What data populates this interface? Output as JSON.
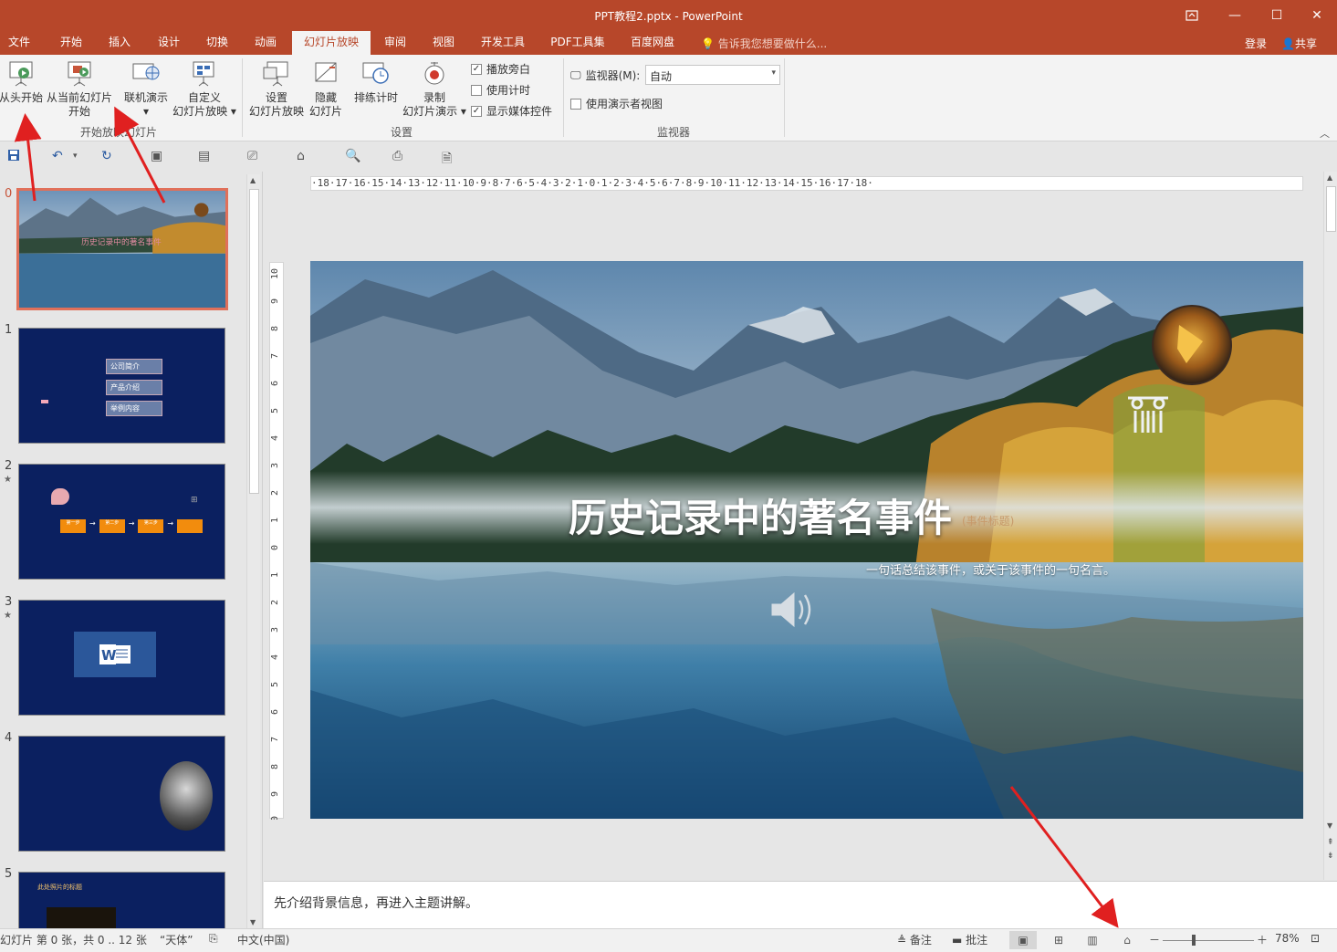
{
  "window": {
    "title": "PPT教程2.pptx - PowerPoint",
    "restore_icon": "restore-icon",
    "minimize": "—",
    "maximize": "☐",
    "close": "✕"
  },
  "tabs": [
    {
      "label": "文件"
    },
    {
      "label": "开始"
    },
    {
      "label": "插入"
    },
    {
      "label": "设计"
    },
    {
      "label": "切换"
    },
    {
      "label": "动画"
    },
    {
      "label": "幻灯片放映"
    },
    {
      "label": "审阅"
    },
    {
      "label": "视图"
    },
    {
      "label": "开发工具"
    },
    {
      "label": "PDF工具集"
    },
    {
      "label": "百度网盘"
    }
  ],
  "tellme": "告诉我您想要做什么...",
  "login": "登录",
  "share": "共享",
  "ribbon": {
    "start_group": {
      "from_beginning": "从头开始",
      "from_current_1": "从当前幻灯片",
      "from_current_2": "开始",
      "online_1": "联机演示",
      "online_2": "▾",
      "custom_1": "自定义",
      "custom_2": "幻灯片放映 ▾",
      "label": "开始放映幻灯片"
    },
    "setup_group": {
      "setup_1": "设置",
      "setup_2": "幻灯片放映",
      "hide_1": "隐藏",
      "hide_2": "幻灯片",
      "rehearse": "排练计时",
      "record_1": "录制",
      "record_2": "幻灯片演示 ▾",
      "play_narration": "播放旁白",
      "use_timings": "使用计时",
      "show_media": "显示媒体控件",
      "label": "设置"
    },
    "monitor_group": {
      "monitor_label": "监视器(M):",
      "monitor_value": "自动",
      "presenter_view": "使用演示者视图",
      "label": "监视器"
    }
  },
  "thumbnails": [
    {
      "num": "0",
      "star": ""
    },
    {
      "num": "1",
      "star": ""
    },
    {
      "num": "2",
      "star": "★"
    },
    {
      "num": "3",
      "star": "★"
    },
    {
      "num": "4",
      "star": ""
    },
    {
      "num": "5",
      "star": ""
    }
  ],
  "thumb_text": {
    "t1_items": [
      "公司简介",
      "产品介绍",
      "举例内容"
    ],
    "t2_items": [
      "第一步",
      "第二步",
      "第三步"
    ],
    "t5_title": "此处照片的标题"
  },
  "ruler": {
    "h": "·18·17·16·15·14·13·12·11·10·9·8·7·6·5·4·3·2·1·0·1·2·3·4·5·6·7·8·9·10·11·12·13·14·15·16·17·18·",
    "v": [
      "10",
      "9",
      "8",
      "7",
      "6",
      "5",
      "4",
      "3",
      "2",
      "1",
      "0",
      "1",
      "2",
      "3",
      "4",
      "5",
      "6",
      "7",
      "8",
      "9",
      "10"
    ]
  },
  "slide": {
    "title": "历史记录中的著名事件",
    "tag": "(事件标题)",
    "subtitle": "一句话总结该事件，或关于该事件的一句名言。"
  },
  "notes": "先介绍背景信息，再进入主题讲解。",
  "status": {
    "slide_info": "幻灯片 第 0 张，共 0 .. 12 张",
    "theme": "“天体”",
    "language": "中文(中国)",
    "notes_btn": "备注",
    "comments_btn": "批注",
    "zoom": "78%"
  },
  "colors": {
    "accent": "#b7472a",
    "selection": "#e0705a",
    "arrow": "#e02020"
  }
}
